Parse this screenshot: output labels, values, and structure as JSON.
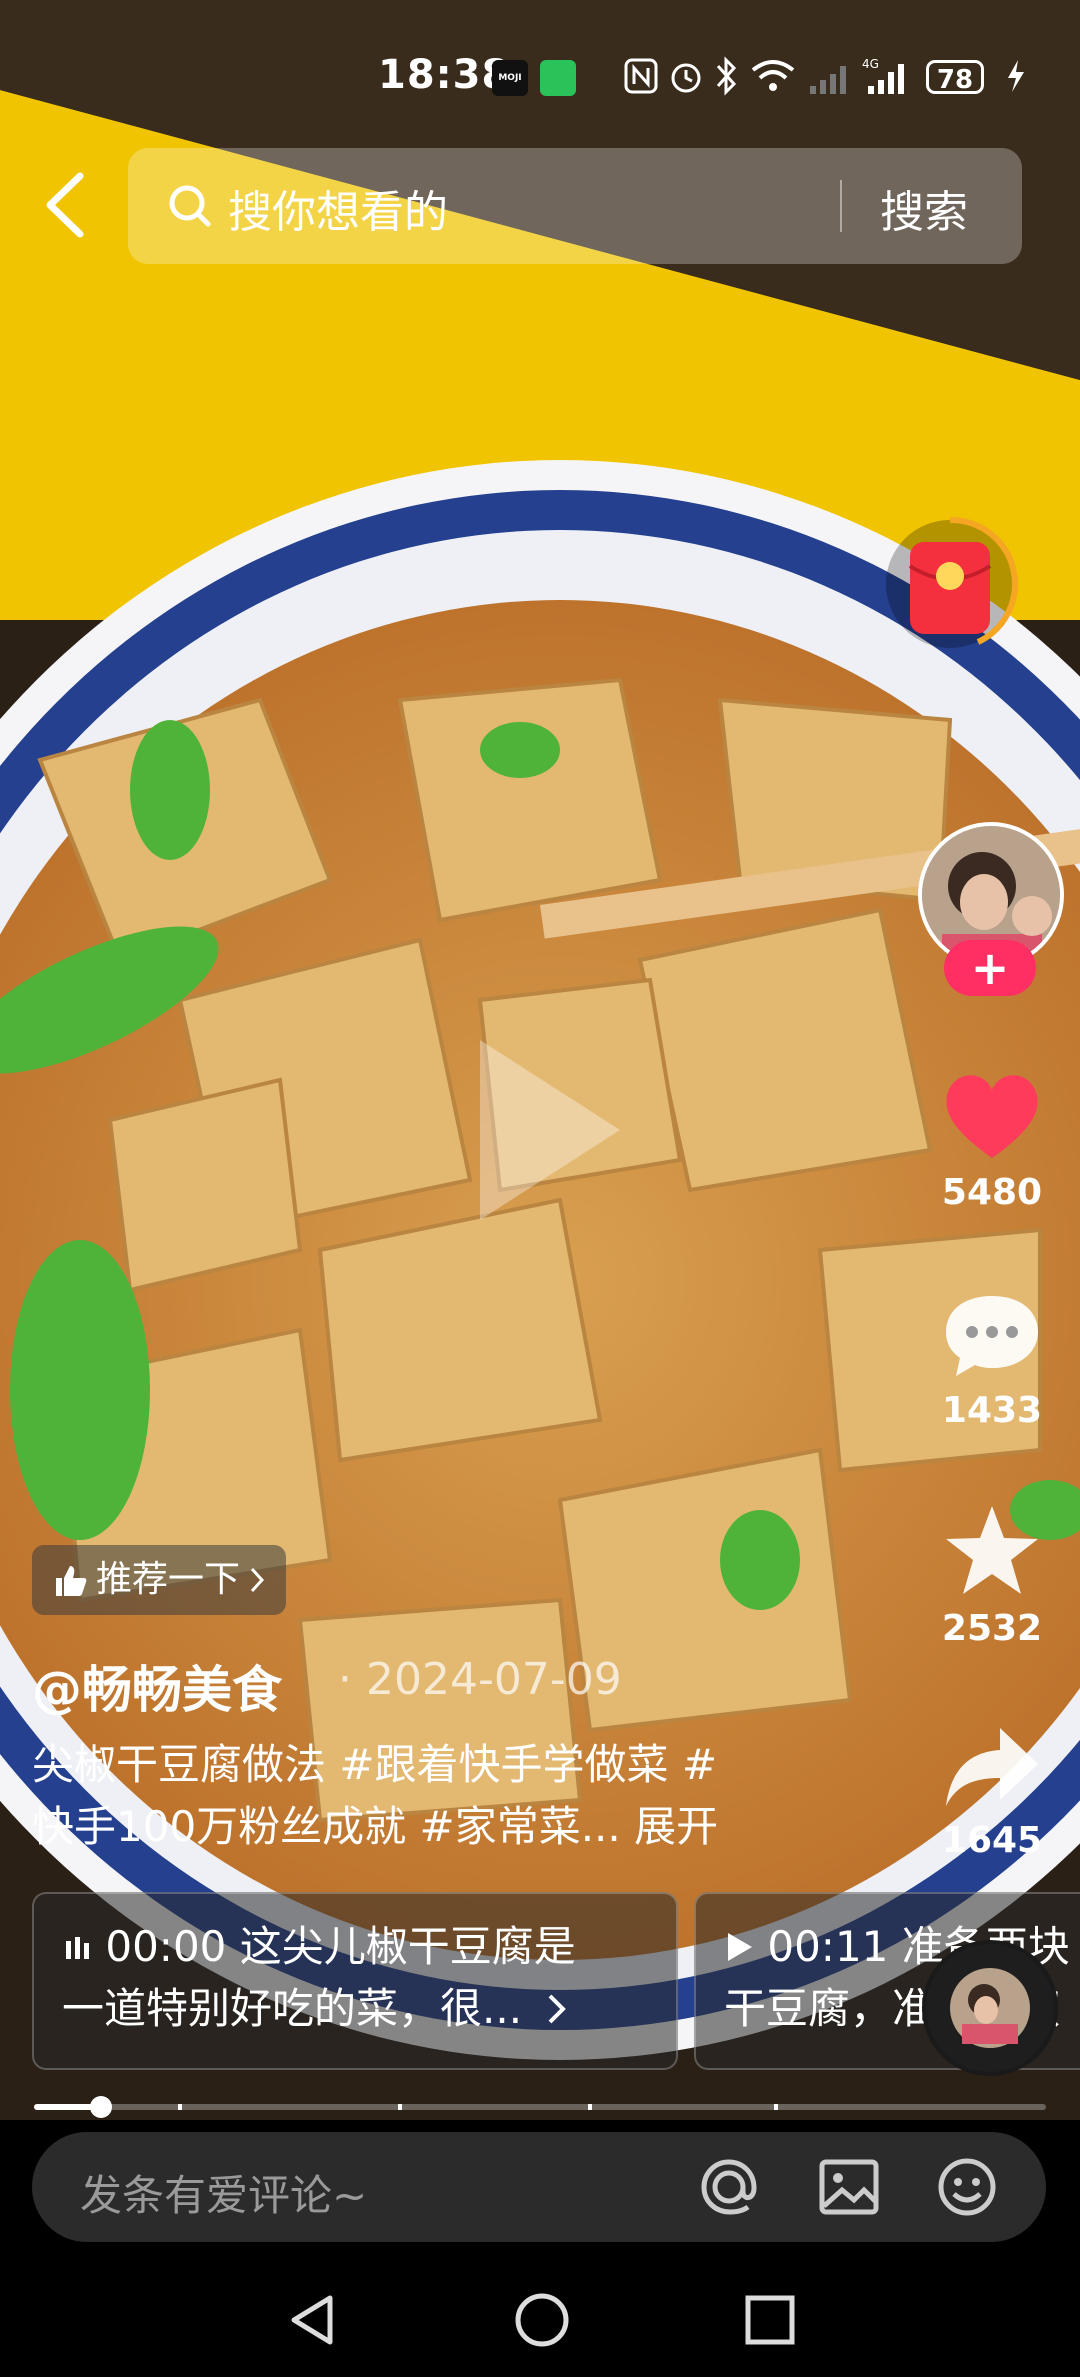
{
  "status_bar": {
    "time": "18:38",
    "weather_app_label": "MOJI",
    "battery": "78"
  },
  "search": {
    "placeholder": "搜你想看的",
    "button_label": "搜索"
  },
  "actions": {
    "likes": "5480",
    "comments": "1433",
    "favorites": "2532",
    "shares": "1645"
  },
  "post": {
    "recommend_label": "推荐一下",
    "author": "@畅畅美食",
    "date": "2024-07-09",
    "description_line1": "尖椒干豆腐做法 #跟着快手学做菜 #",
    "description_line2": "快手100万粉丝成就 #家常菜... 展开"
  },
  "chapters": [
    {
      "line1_time": "00:00",
      "line1_text": " 这尖儿椒干豆腐是",
      "line2": "一道特别好吃的菜，很..."
    },
    {
      "line1_time": "00:11",
      "line1_text": " 准备两块",
      "line2": "干豆腐，准备尖椒"
    }
  ],
  "playback": {
    "progress_fraction": 0.066
  },
  "comment": {
    "placeholder": "发条有爱评论~"
  },
  "colors": {
    "accent": "#ff2e63",
    "heart": "#ff3b5c",
    "background_yellow": "#f2c800"
  }
}
